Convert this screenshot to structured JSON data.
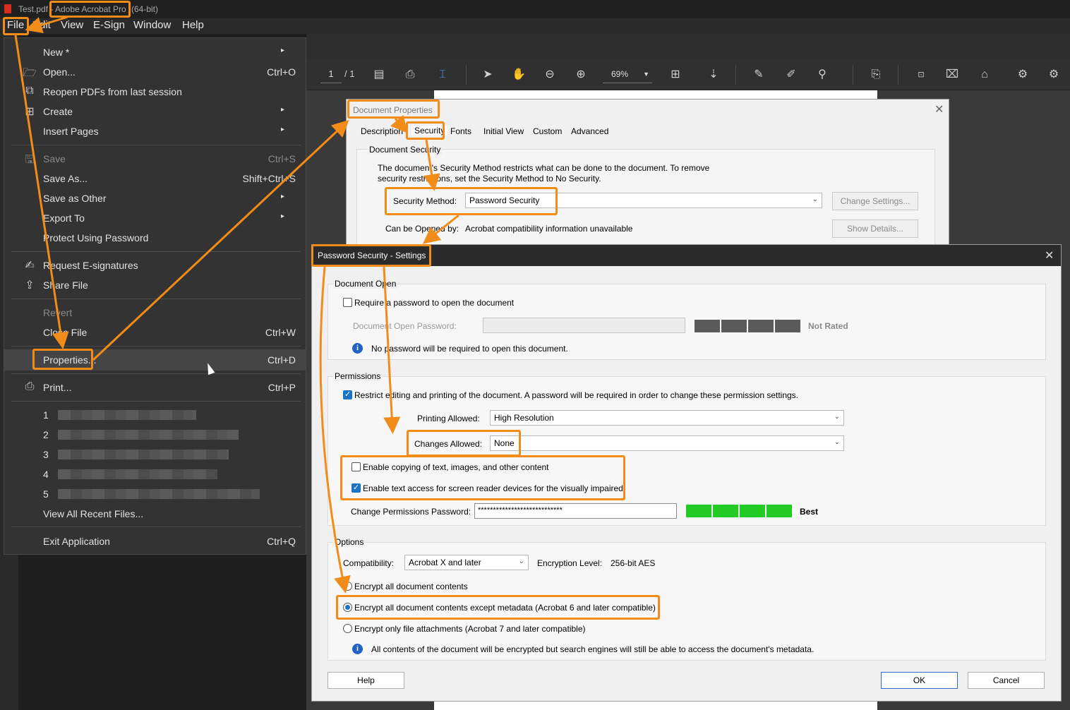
{
  "titlebar": {
    "file": "Test.pdf -",
    "app": "Adobe Acrobat Pro",
    "suffix": "(64-bit)"
  },
  "menubar": [
    "File",
    "Edit",
    "View",
    "E-Sign",
    "Window",
    "Help"
  ],
  "toolbar": {
    "page_current": "1",
    "page_total": "/ 1",
    "zoom": "69%"
  },
  "file_menu": {
    "new": "New *",
    "open": "Open...",
    "open_sc": "Ctrl+O",
    "reopen": "Reopen PDFs from last session",
    "create": "Create",
    "insert_pages": "Insert Pages",
    "save": "Save",
    "save_sc": "Ctrl+S",
    "save_as": "Save As...",
    "save_as_sc": "Shift+Ctrl+S",
    "save_as_other": "Save as Other",
    "export_to": "Export To",
    "protect": "Protect Using Password",
    "request_esign": "Request E-signatures",
    "share_file": "Share File",
    "revert": "Revert",
    "close_file": "Close File",
    "close_sc": "Ctrl+W",
    "properties": "Properties...",
    "properties_sc": "Ctrl+D",
    "print": "Print...",
    "print_sc": "Ctrl+P",
    "recent": [
      "1",
      "2",
      "3",
      "4",
      "5"
    ],
    "view_all_recent": "View All Recent Files...",
    "exit": "Exit Application",
    "exit_sc": "Ctrl+Q"
  },
  "doc_props": {
    "title": "Document Properties",
    "tabs": [
      "Description",
      "Security",
      "Fonts",
      "Initial View",
      "Custom",
      "Advanced"
    ],
    "section": "Document Security",
    "desc_line1": "The document's Security Method restricts what can be done to the document. To remove",
    "desc_line2": "security restrictions, set the Security Method to No Security.",
    "method_label": "Security Method:",
    "method_value": "Password Security",
    "change_settings": "Change Settings...",
    "opened_label": "Can be Opened by:",
    "opened_value": "Acrobat compatibility information unavailable",
    "show_details": "Show Details..."
  },
  "pw_security": {
    "title": "Password Security - Settings",
    "doc_open": "Document Open",
    "require_pw": "Require a password to open the document",
    "doc_open_pw_label": "Document Open Password:",
    "not_rated": "Not Rated",
    "no_pw_note": "No password will be required to open this document.",
    "permissions": "Permissions",
    "restrict": "Restrict editing and printing of the document. A password will be required in order to change these permission settings.",
    "printing_label": "Printing Allowed:",
    "printing_value": "High Resolution",
    "changes_label": "Changes Allowed:",
    "changes_value": "None",
    "enable_copy": "Enable copying of text, images, and other content",
    "enable_screen": "Enable text access for screen reader devices for the visually impaired",
    "change_pw_label": "Change Permissions Password:",
    "change_pw_value": "****************************",
    "strength": "Best",
    "options": "Options",
    "compat_label": "Compatibility:",
    "compat_value": "Acrobat X and later",
    "enc_label": "Encryption  Level:",
    "enc_value": "256-bit AES",
    "enc_all": "Encrypt all document contents",
    "enc_except_meta": "Encrypt all document contents except metadata (Acrobat 6 and later compatible)",
    "enc_attach": "Encrypt only file attachments (Acrobat 7 and later compatible)",
    "enc_note": "All contents of the document will be encrypted but search engines will still be able to access the document's metadata.",
    "help": "Help",
    "ok": "OK",
    "cancel": "Cancel"
  },
  "colors": {
    "annotation": "#f28c18",
    "meter_good": "#22cc22",
    "meter_empty": "#5a5a5a",
    "accent": "#1a73c9"
  }
}
